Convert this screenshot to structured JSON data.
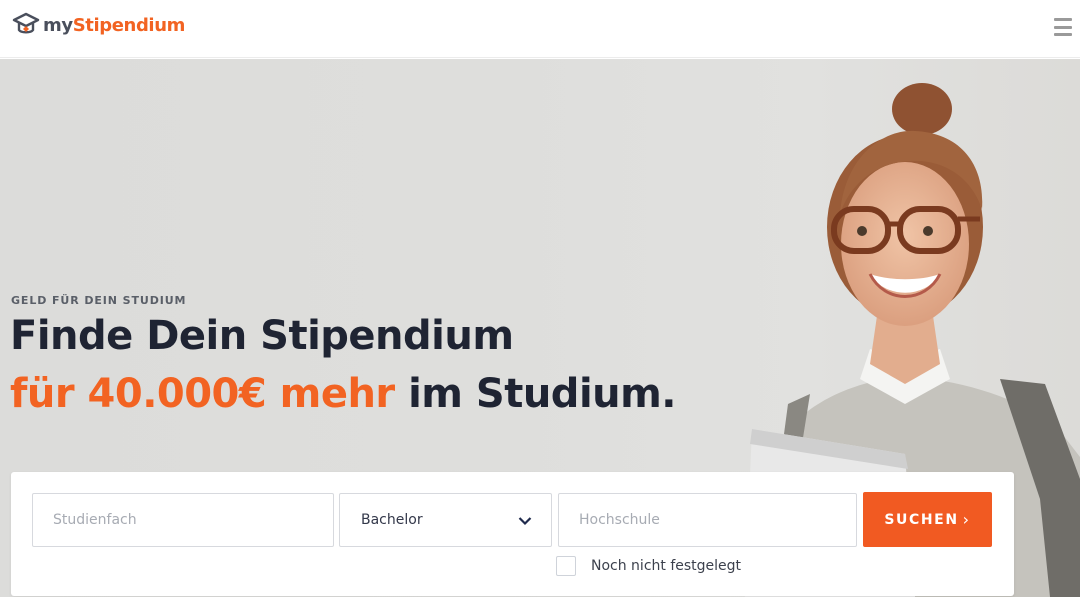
{
  "header": {
    "logo_icon": "graduation-cap-logo-icon",
    "logo_my": "my",
    "logo_brand": "Stipendium",
    "menu_icon": "hamburger-menu-icon"
  },
  "hero": {
    "eyebrow": "GELD FÜR DEIN STUDIUM",
    "headline_line1": "Finde Dein Stipendium",
    "headline_accent": "für 40.000€ mehr",
    "headline_rest": " im Studium."
  },
  "search": {
    "studienfach_placeholder": "Studienfach",
    "degree_value": "Bachelor",
    "hochschule_placeholder": "Hochschule",
    "submit_label": "SUCHEN",
    "submit_arrow": "›",
    "undecided_label": "Noch nicht festgelegt",
    "undecided_checked": false
  },
  "colors": {
    "accent": "#f26322",
    "dark_text": "#1f2433"
  }
}
